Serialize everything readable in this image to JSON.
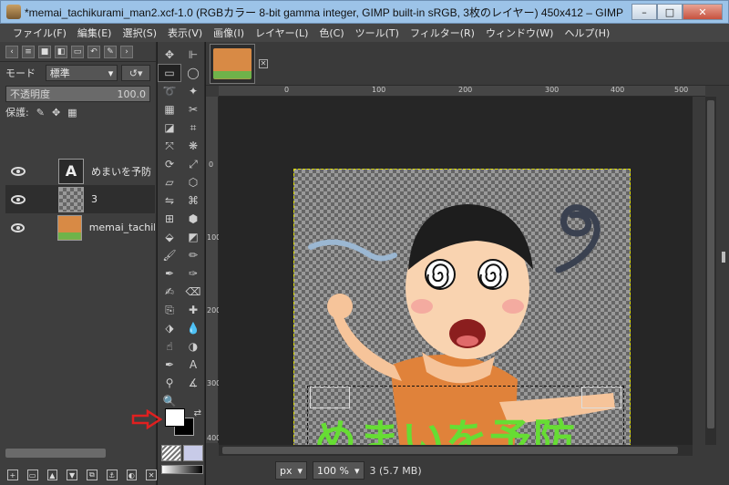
{
  "window": {
    "title": "*memai_tachikurami_man2.xcf-1.0 (RGBカラー 8-bit gamma integer, GIMP built-in sRGB, 3枚のレイヤー) 450x412 – GIMP",
    "minimize": "–",
    "maximize": "□",
    "close": "✕"
  },
  "menu": [
    "ファイル(F)",
    "編集(E)",
    "選択(S)",
    "表示(V)",
    "画像(I)",
    "レイヤー(L)",
    "色(C)",
    "ツール(T)",
    "フィルター(R)",
    "ウィンドウ(W)",
    "ヘルプ(H)"
  ],
  "layers_panel": {
    "mode_label": "モード",
    "mode_value": "標準",
    "opacity_label": "不透明度",
    "opacity_value": "100.0",
    "opacity_fraction": 1.0,
    "lock_label": "保護:",
    "layers": [
      {
        "name": "めまいを予防",
        "thumb": "text",
        "active": false
      },
      {
        "name": "3",
        "thumb": "checker",
        "active": true
      },
      {
        "name": "memai_tachik",
        "thumb": "img",
        "active": false
      }
    ]
  },
  "ruler": {
    "labels": [
      "0",
      "100",
      "200",
      "300",
      "400",
      "500"
    ],
    "left_labels": [
      "0",
      "100",
      "200",
      "300",
      "400"
    ]
  },
  "canvas_text": "めまいを予防",
  "statusbar": {
    "unit": "px",
    "zoom": "100 %",
    "info": "3 (5.7 MB)"
  },
  "colors": {
    "foreground": "#ffffff",
    "background": "#000000",
    "overlay_text": "#66dd33",
    "arrow": "#e02020"
  }
}
